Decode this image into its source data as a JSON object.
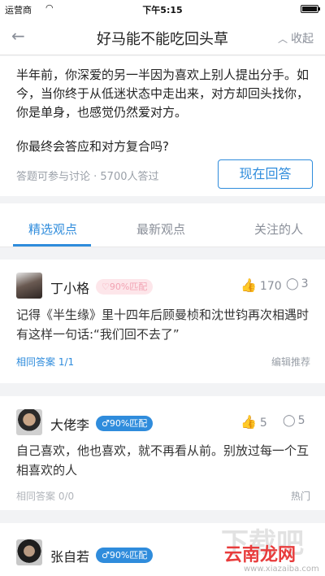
{
  "status_bar": {
    "carrier": "运营商",
    "time": "下午5:15"
  },
  "nav": {
    "title": "好马能不能吃回头草",
    "collapse_label": "收起"
  },
  "question": {
    "body": "半年前，你深爱的另一半因为喜欢上别人提出分手。如今，当你终于从低迷状态中走出来，对方却回头找你，你是单身，也感觉仍然爱对方。",
    "ask": "你最终会答应和对方复合吗?",
    "meta": "答题可参与讨论 · 5700人答过",
    "answer_button": "现在回答"
  },
  "tabs": [
    {
      "label": "精选观点",
      "active": true
    },
    {
      "label": "最新观点",
      "active": false
    },
    {
      "label": "关注的人",
      "active": false
    }
  ],
  "answers": [
    {
      "name": "丁小格",
      "match": "♡90%匹配",
      "likes": "170",
      "comments": "3",
      "content": "记得《半生缘》里十四年后顾曼桢和沈世钧再次相遇时有这样一句话:“我们回不去了”",
      "same": "相同答案 1/1",
      "tag": "编辑推荐"
    },
    {
      "name": "大佬李",
      "match": "♂90%匹配",
      "likes": "5",
      "comments": "5",
      "content": "自己喜欢，他也喜欢，就不再看从前。别放过每一个互相喜欢的人",
      "same": "相同答案 0/0",
      "tag": "热门"
    },
    {
      "name": "张自若",
      "match": "♂90%匹配"
    }
  ],
  "watermark": {
    "big": "下载吧",
    "brand": "云南龙网",
    "url": "www.xiazaiba.com"
  },
  "colors": {
    "accent": "#2f8cdc",
    "match_pink_bg": "#fde6ea",
    "brand_red": "#e83c3c"
  },
  "icons": [
    "back-arrow-icon",
    "chevron-up-icon",
    "wifi-icon",
    "battery-icon",
    "thumb-up-icon",
    "comment-bubble-icon",
    "avatar"
  ]
}
